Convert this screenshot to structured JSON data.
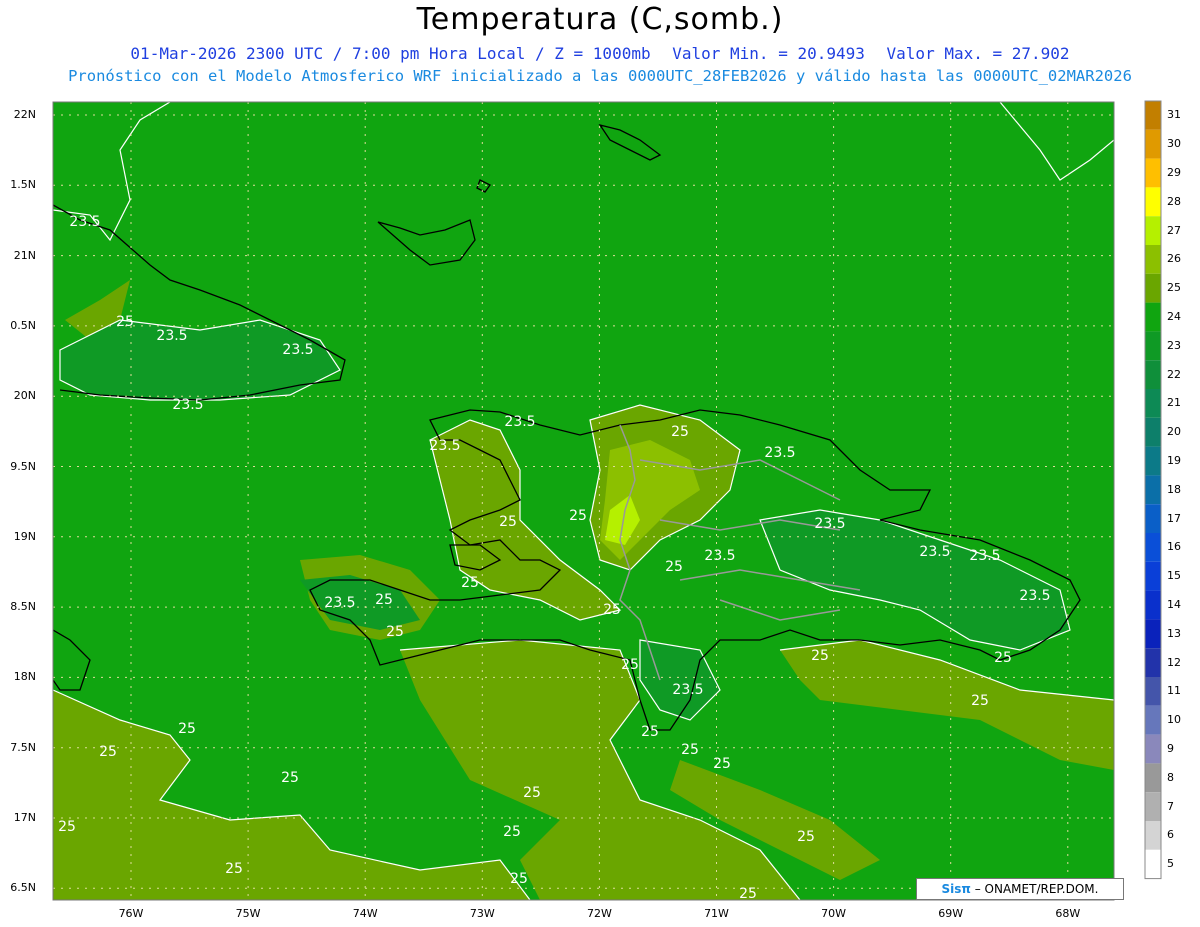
{
  "title": "Temperatura (C,somb.)",
  "subtitle": {
    "valid_time": "01-Mar-2026 2300 UTC / 7:00 pm Hora Local / Z = 1000mb",
    "min": "Valor Min. = 20.9493",
    "max": "Valor Max. = 27.902"
  },
  "forecast_note": "Pronóstico con el Modelo Atmosferico WRF inicializado a las 0000UTC_28FEB2026 y válido hasta las  0000UTC_02MAR2026",
  "latitude_ticks": [
    "22N",
    "1.5N",
    "21N",
    "0.5N",
    "20N",
    "9.5N",
    "19N",
    "8.5N",
    "18N",
    "7.5N",
    "17N",
    "6.5N"
  ],
  "longitude_ticks": [
    "76W",
    "75W",
    "74W",
    "73W",
    "72W",
    "71W",
    "70W",
    "69W",
    "68W"
  ],
  "colorbar": {
    "labels": [
      "31",
      "30",
      "29",
      "28",
      "27",
      "26",
      "25",
      "24",
      "23",
      "22",
      "21",
      "20",
      "19",
      "18",
      "17",
      "16",
      "15",
      "14",
      "13",
      "12",
      "11",
      "10",
      "9",
      "8",
      "7",
      "6",
      "5"
    ],
    "colors": [
      "#c27f00",
      "#e09a00",
      "#ffbf00",
      "#ffff00",
      "#b5f000",
      "#8cc000",
      "#6aa600",
      "#10a510",
      "#0f9a25",
      "#0f8f3a",
      "#0d8a55",
      "#0d7f6a",
      "#0c7a88",
      "#0b6fa8",
      "#0a5fc8",
      "#0a4fd8",
      "#0a3fd8",
      "#0a30cc",
      "#0a22bb",
      "#2233aa",
      "#4455aa",
      "#6677bb",
      "#8a88bb",
      "#999999",
      "#b0b0b0",
      "#d4d4d4",
      "#ffffff"
    ]
  },
  "contour_labels": [
    "23.5",
    "25"
  ],
  "credit": {
    "logo": "Sisπ",
    "text": " – ONAMET/REP.DOM."
  },
  "colors": {
    "sea": "#10a510",
    "warm": "#6aa600",
    "hot": "#8cc000",
    "cool": "#0f9a25",
    "coast": "#000000",
    "border": "#999999"
  }
}
